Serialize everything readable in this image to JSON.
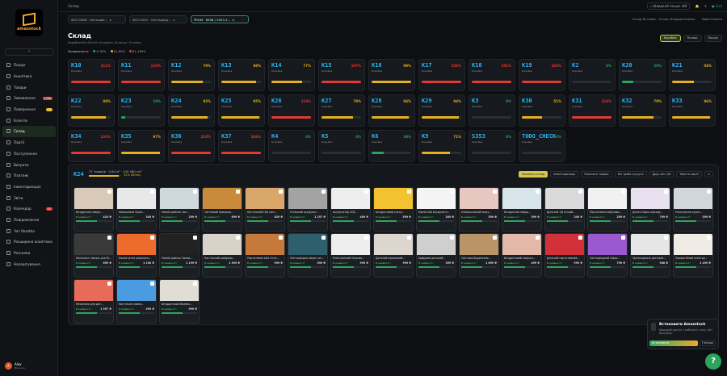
{
  "app": {
    "logo_text": "amazstock"
  },
  "sidebar": {
    "collapse_label": "«",
    "items": [
      {
        "label": "Пошук",
        "badge": ""
      },
      {
        "label": "Аналітика",
        "badge": ""
      },
      {
        "label": "Товари",
        "badge": ""
      },
      {
        "label": "Замовлення",
        "badge": "1759"
      },
      {
        "label": "Повернення",
        "badge": "12"
      },
      {
        "label": "Клієнти",
        "badge": ""
      },
      {
        "label": "Склад",
        "badge": ""
      },
      {
        "label": "Партії",
        "badge": ""
      },
      {
        "label": "Поступлення",
        "badge": ""
      },
      {
        "label": "Витрати",
        "badge": ""
      },
      {
        "label": "Платежі",
        "badge": ""
      },
      {
        "label": "Інвентаризація",
        "badge": ""
      },
      {
        "label": "Звіти",
        "badge": ""
      },
      {
        "label": "Календар",
        "badge": "21"
      },
      {
        "label": "Повідомлення",
        "badge": ""
      },
      {
        "label": "Чат Rozetka",
        "badge": ""
      },
      {
        "label": "Розширена аналітика",
        "badge": ""
      },
      {
        "label": "Розсилки",
        "badge": ""
      },
      {
        "label": "Налаштування",
        "badge": ""
      }
    ],
    "active_index": 6,
    "user": {
      "initial": "A",
      "name": "Alex",
      "role": "Власник"
    }
  },
  "topbar": {
    "breadcrumb": "Склад",
    "search_label": "Швидкий пошук",
    "search_shortcut": "⌘K",
    "status": "Live"
  },
  "tabs": [
    {
      "label": "SEO-0408 · Світлодіо..."
    },
    {
      "label": "SEO-0520 · Світлодіод..."
    },
    {
      "label": "PROM · 8458 / 2023.3..."
    }
  ],
  "tab_info": {
    "left": "Склад № сервіс · Огляд 16 відвантажено",
    "right": "Завантажити"
  },
  "page": {
    "title": "Склад",
    "subtitle": "Коробки 60×50×50 см мають 43 місць і 6 ячеек",
    "legend_label": "Заповненість:",
    "legend": [
      {
        "label": "0–50%",
        "color": "#2aa55a"
      },
      {
        "label": "51–80%",
        "color": "#e5b11e"
      },
      {
        "label": "81–100%",
        "color": "#e53935"
      }
    ],
    "buttons": [
      "Коробки",
      "Полиці",
      "Пошук"
    ]
  },
  "cells": [
    {
      "name": "K10",
      "pct": "111%",
      "fill": 100,
      "color": "#e53935"
    },
    {
      "name": "K11",
      "pct": "119%",
      "fill": 100,
      "color": "#e53935"
    },
    {
      "name": "K12",
      "pct": "79%",
      "fill": 79,
      "color": "#e5b11e"
    },
    {
      "name": "K13",
      "pct": "88%",
      "fill": 88,
      "color": "#e5b11e"
    },
    {
      "name": "K14",
      "pct": "77%",
      "fill": 77,
      "color": "#e5b11e"
    },
    {
      "name": "K15",
      "pct": "107%",
      "fill": 100,
      "color": "#e53935"
    },
    {
      "name": "K16",
      "pct": "99%",
      "fill": 99,
      "color": "#e5b11e"
    },
    {
      "name": "K17",
      "pct": "158%",
      "fill": 100,
      "color": "#e53935"
    },
    {
      "name": "K18",
      "pct": "151%",
      "fill": 100,
      "color": "#e53935"
    },
    {
      "name": "K19",
      "pct": "103%",
      "fill": 100,
      "color": "#e53935"
    },
    {
      "name": "K2",
      "pct": "0%",
      "fill": 0,
      "color": "#2aa55a"
    },
    {
      "name": "K20",
      "pct": "29%",
      "fill": 29,
      "color": "#2aa55a"
    },
    {
      "name": "K21",
      "pct": "56%",
      "fill": 56,
      "color": "#e5b11e"
    },
    {
      "name": "K22",
      "pct": "88%",
      "fill": 88,
      "color": "#e5b11e"
    },
    {
      "name": "K23",
      "pct": "10%",
      "fill": 10,
      "color": "#2aa55a"
    },
    {
      "name": "K24",
      "pct": "92%",
      "fill": 92,
      "color": "#e5b11e"
    },
    {
      "name": "K25",
      "pct": "95%",
      "fill": 95,
      "color": "#e5b11e"
    },
    {
      "name": "K26",
      "pct": "113%",
      "fill": 100,
      "color": "#e53935"
    },
    {
      "name": "K27",
      "pct": "79%",
      "fill": 79,
      "color": "#e5b11e"
    },
    {
      "name": "K28",
      "pct": "94%",
      "fill": 94,
      "color": "#e5b11e"
    },
    {
      "name": "K29",
      "pct": "94%",
      "fill": 94,
      "color": "#e5b11e"
    },
    {
      "name": "K3",
      "pct": "0%",
      "fill": 0,
      "color": "#2aa55a"
    },
    {
      "name": "K30",
      "pct": "51%",
      "fill": 51,
      "color": "#e5b11e"
    },
    {
      "name": "K31",
      "pct": "114%",
      "fill": 100,
      "color": "#e53935"
    },
    {
      "name": "K32",
      "pct": "79%",
      "fill": 79,
      "color": "#e5b11e"
    },
    {
      "name": "K33",
      "pct": "96%",
      "fill": 96,
      "color": "#e5b11e"
    },
    {
      "name": "K34",
      "pct": "133%",
      "fill": 100,
      "color": "#e53935"
    },
    {
      "name": "K35",
      "pct": "97%",
      "fill": 97,
      "color": "#e5b11e"
    },
    {
      "name": "K36",
      "pct": "210%",
      "fill": 100,
      "color": "#e53935"
    },
    {
      "name": "K37",
      "pct": "246%",
      "fill": 100,
      "color": "#e53935"
    },
    {
      "name": "K4",
      "pct": "0%",
      "fill": 0,
      "color": "#2aa55a"
    },
    {
      "name": "K5",
      "pct": "0%",
      "fill": 0,
      "color": "#2aa55a"
    },
    {
      "name": "K6",
      "pct": "30%",
      "fill": 30,
      "color": "#2aa55a"
    },
    {
      "name": "K9",
      "pct": "71%",
      "fill": 71,
      "color": "#e5b11e"
    },
    {
      "name": "S353",
      "pct": "0%",
      "fill": 0,
      "color": "#2aa55a"
    },
    {
      "name": "TODO_CHECK",
      "pct": "0%",
      "fill": 0,
      "color": "#2aa55a"
    }
  ],
  "cell_status": "Коробка",
  "panel": {
    "name": "K24",
    "stat": "37 товарів · 0.64 м³ · 105 480 см³",
    "pct": "92% об'єму",
    "fill": 92,
    "toolbar": [
      "Показати склад",
      "Інвентаризація",
      "Показати товари",
      "Які треба зсунути",
      "Друк всіх QR",
      "Звести партії",
      "×"
    ]
  },
  "products": [
    {
      "name": "Бездротові навуш...",
      "stock": "В наявності",
      "price": "419 ₴",
      "c": "#d8c9b8"
    },
    {
      "name": "Навушники Super...",
      "stock": "В наявності",
      "price": "349 ₴",
      "c": "#e8e8e8"
    },
    {
      "name": "Умний дзвінок Зал...",
      "stock": "В наявності",
      "price": "299 ₴",
      "c": "#cfd8dc"
    },
    {
      "name": "Світловий прикраш...",
      "stock": "В наявності",
      "price": "699 ₴",
      "c": "#c98b3a"
    },
    {
      "name": "Настільний LED лам...",
      "stock": "В наявності",
      "price": "629 ₴",
      "c": "#d9a76a"
    },
    {
      "name": "Успішний акумулят...",
      "stock": "В наявності",
      "price": "1 197 ₴",
      "c": "#a3a3a3"
    },
    {
      "name": "Акумулятор LED...",
      "stock": "В наявності",
      "price": "499 ₴",
      "c": "#eeeeee"
    },
    {
      "name": "Бездротовий ультр...",
      "stock": "В наявності",
      "price": "599 ₴",
      "c": "#f2c230"
    },
    {
      "name": "Ефектний Акумулято...",
      "stock": "В наявності",
      "price": "349 ₴",
      "c": "#f4f4f4"
    },
    {
      "name": "Універсальний кожу...",
      "stock": "В наявності",
      "price": "599 ₴",
      "c": "#e8c7c1"
    },
    {
      "name": "Бездротові навуш...",
      "stock": "В наявності",
      "price": "399 ₴",
      "c": "#d7e4ea"
    },
    {
      "name": "Дитячий 3Д нічний...",
      "stock": "В наявності",
      "price": "349 ₴",
      "c": "#dadada"
    },
    {
      "name": "Портативна вибухова...",
      "stock": "В наявності",
      "price": "299 ₴",
      "c": "#f1f1f1"
    },
    {
      "name": "Дитячі відео прилад...",
      "stock": "В наявності",
      "price": "799 ₴",
      "c": "#e9e0f0"
    },
    {
      "name": "Електрична кухон...",
      "stock": "В наявності",
      "price": "599 ₴",
      "c": "#d0d6db"
    },
    {
      "name": "Комплект ніжних для Bl...",
      "stock": "В наявності",
      "price": "699 ₴",
      "c": "#3a3a3a"
    },
    {
      "name": "Косметичне дзеркало...",
      "stock": "В наявності",
      "price": "1 100 ₴",
      "c": "#ec6a2a"
    },
    {
      "name": "Умний дзвінок Замка...",
      "stock": "В наявності",
      "price": "1 199 ₴",
      "c": "#222222"
    },
    {
      "name": "Настільний цифрово...",
      "stock": "В наявності",
      "price": "1 399 ₴",
      "c": "#d8d2c8"
    },
    {
      "name": "Портативна міні сісте...",
      "stock": "В наявності",
      "price": "999 ₴",
      "c": "#c57a3c"
    },
    {
      "name": "Світлодіодна мікро гол...",
      "stock": "В наявності",
      "price": "599 ₴",
      "c": "#2e5f6c"
    },
    {
      "name": "Електронний пілосмо...",
      "stock": "В наявності",
      "price": "999 ₴",
      "c": "#eeeeee"
    },
    {
      "name": "Дитячий керований...",
      "stock": "В наявності",
      "price": "999 ₴",
      "c": "#dcd6cf"
    },
    {
      "name": "Цифрова дитячий...",
      "stock": "В наявності",
      "price": "399 ₴",
      "c": "#cfcfcf"
    },
    {
      "name": "Світлова будильник...",
      "stock": "В наявності",
      "price": "1 899 ₴",
      "c": "#b89466"
    },
    {
      "name": "Бездротовий навушн...",
      "stock": "В наявності",
      "price": "499 ₴",
      "c": "#e3b8a8"
    },
    {
      "name": "Дитячий портативний...",
      "stock": "В наявності",
      "price": "999 ₴",
      "c": "#d2303a"
    },
    {
      "name": "Світлодіодний мікро...",
      "stock": "В наявності",
      "price": "799 ₴",
      "c": "#9b59d0"
    },
    {
      "name": "Ортопедична дитячий...",
      "stock": "В наявності",
      "price": "908 ₴",
      "c": "#e6e6e6"
    },
    {
      "name": "Професійний електро...",
      "stock": "В наявності",
      "price": "1 499 ₴",
      "c": "#f0ece5"
    },
    {
      "name": "Мезонина для дит...",
      "stock": "В наявності",
      "price": "1 997 ₴",
      "c": "#e66b58"
    },
    {
      "name": "Настільна лампа...",
      "stock": "В наявності",
      "price": "599 ₴",
      "c": "#4b9be0"
    },
    {
      "name": "Бездротовий Bluetoo...",
      "stock": "В наявності",
      "price": "999 ₴",
      "c": "#e1ddd5"
    }
  ],
  "popup": {
    "title": "Встановити Amazstock",
    "desc": "Швидкий доступ з робочого столу. Без браузера.",
    "install": "Встановити",
    "later": "Пізніше"
  },
  "help": {
    "label": "?"
  }
}
